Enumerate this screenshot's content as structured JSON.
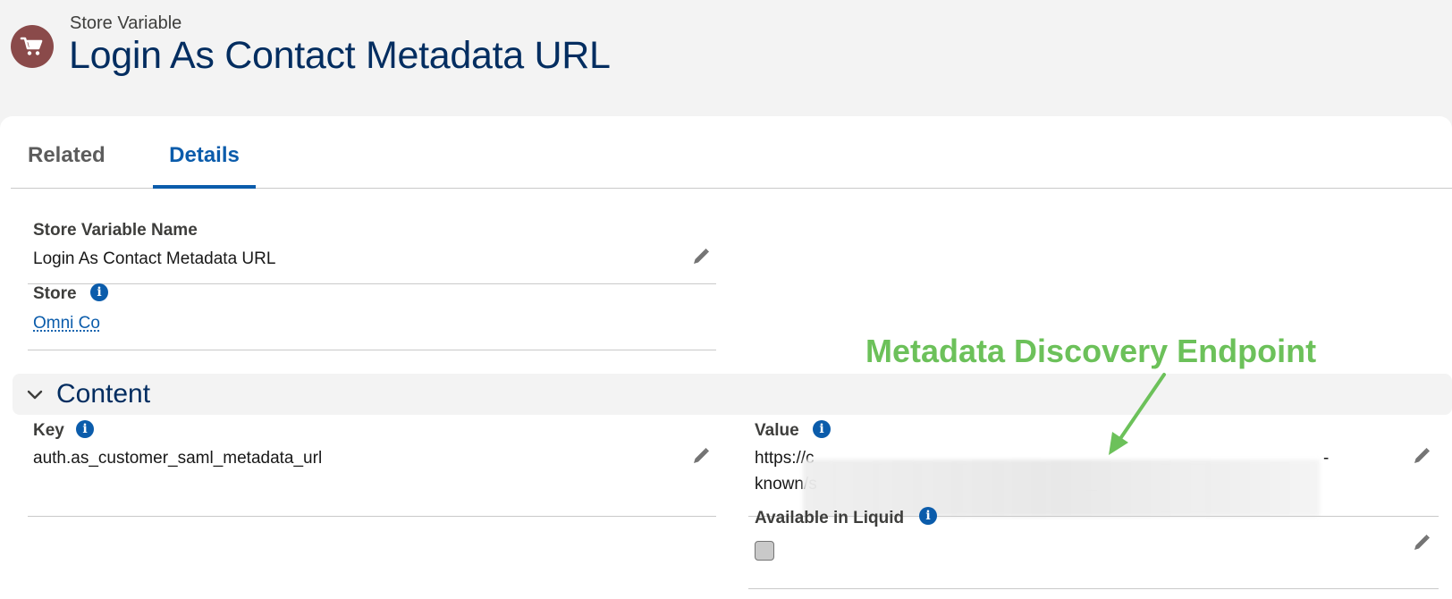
{
  "header": {
    "object_type": "Store Variable",
    "record_title": "Login As Contact Metadata URL",
    "icon": "shopping-cart-icon"
  },
  "tabs": [
    {
      "label": "Related",
      "active": false
    },
    {
      "label": "Details",
      "active": true
    }
  ],
  "fields": {
    "store_variable_name": {
      "label": "Store Variable Name",
      "value": "Login As Contact Metadata URL"
    },
    "store": {
      "label": "Store",
      "value": "Omni Co"
    }
  },
  "content_section": {
    "title": "Content",
    "key": {
      "label": "Key",
      "value": "auth.as_customer_saml_metadata_url"
    },
    "value": {
      "label": "Value",
      "line1": "https://c",
      "line1_end": "-",
      "line2": "known/s",
      "line2_end": "_"
    },
    "available_in_liquid": {
      "label": "Available in Liquid",
      "checked": false
    }
  },
  "annotation": {
    "text": "Metadata Discovery Endpoint",
    "color": "#6cc15a"
  },
  "colors": {
    "accent": "#0b5cab",
    "title": "#032d60",
    "icon_bg": "#8a4a4a"
  }
}
